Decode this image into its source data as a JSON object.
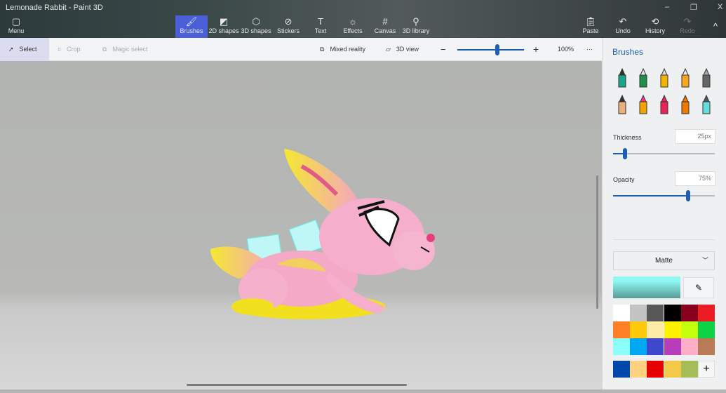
{
  "window": {
    "title": "Lemonade Rabbit - Paint 3D",
    "minimize": "–",
    "maximize": "❐",
    "close": "X"
  },
  "menu": {
    "label": "Menu"
  },
  "tools": [
    {
      "label": "Brushes"
    },
    {
      "label": "2D shapes"
    },
    {
      "label": "3D shapes"
    },
    {
      "label": "Stickers"
    },
    {
      "label": "Text"
    },
    {
      "label": "Effects"
    },
    {
      "label": "Canvas"
    },
    {
      "label": "3D library"
    }
  ],
  "actions": [
    {
      "label": "Paste"
    },
    {
      "label": "Undo"
    },
    {
      "label": "History"
    },
    {
      "label": "Redo"
    }
  ],
  "toolbar2": {
    "select": "Select",
    "crop": "Crop",
    "magic_select": "Magic select",
    "mixed_reality": "Mixed reality",
    "view_3d": "3D view",
    "zoom_minus": "−",
    "zoom_plus": "+",
    "zoom_value": "100%",
    "zoom_level": 0.6,
    "more": "···"
  },
  "panel": {
    "title": "Brushes",
    "thickness_label": "Thickness",
    "thickness_value": "25px",
    "thickness_level": 0.12,
    "opacity_label": "Opacity",
    "opacity_value": "75%",
    "opacity_level": 0.74,
    "finish": "Matte",
    "add_color": "+",
    "brushes": [
      "marker",
      "calligraphy-pen",
      "oil-brush",
      "watercolor",
      "pixel-pen",
      "pencil",
      "eraser",
      "crayon",
      "spray-can",
      "fill"
    ],
    "current_color": "#8ff8f4",
    "palette": [
      "#ffffff",
      "#c3c3c3",
      "#585858",
      "#000000",
      "#88001b",
      "#ec1c24",
      "#ff7f27",
      "#ffc90e",
      "#fdeca6",
      "#fff200",
      "#c4ff0e",
      "#0ed145",
      "#8cfffb",
      "#00a8f3",
      "#3f48cc",
      "#b83dba",
      "#ffaec8",
      "#b97a56"
    ],
    "custom": [
      "#0047ab",
      "#ffd27f",
      "#e70000",
      "#f4c94a",
      "#a5bd56"
    ]
  }
}
